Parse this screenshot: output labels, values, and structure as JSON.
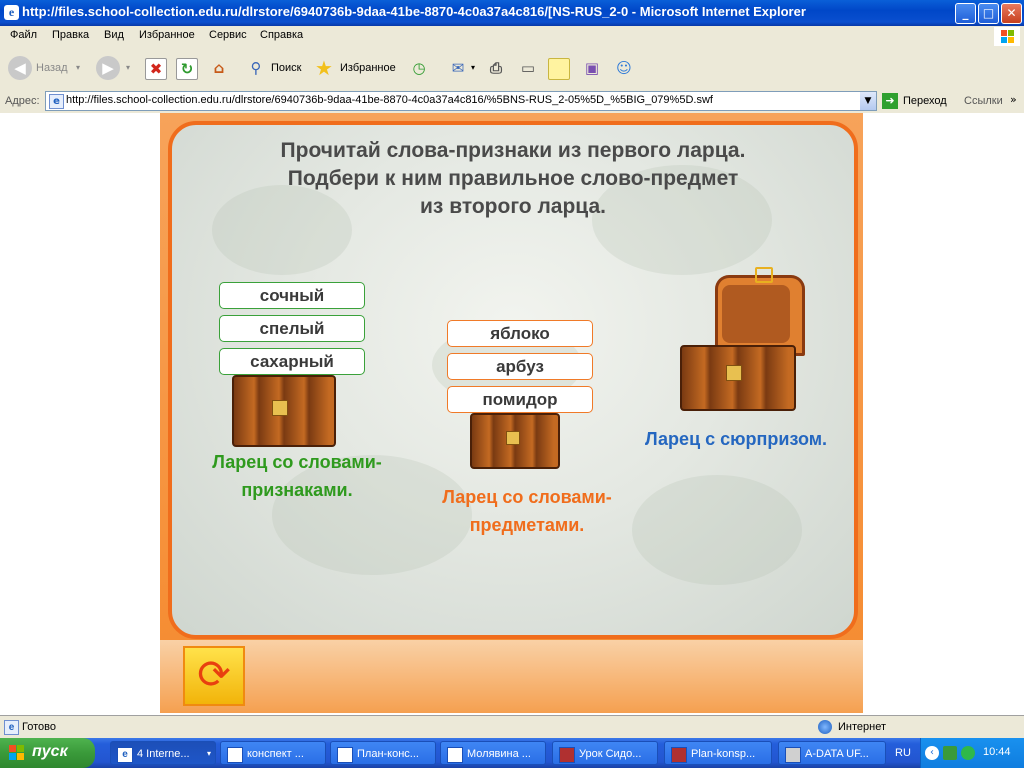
{
  "window": {
    "title": "http://files.school-collection.edu.ru/dlrstore/6940736b-9daa-41be-8870-4c0a37a4c816/[NS-RUS_2-0 - Microsoft Internet Explorer",
    "icon": "ie-icon",
    "controls": {
      "minimize": "_",
      "maximize": "□",
      "close": "✕"
    }
  },
  "menu": {
    "items": [
      "Файл",
      "Правка",
      "Вид",
      "Избранное",
      "Сервис",
      "Справка"
    ]
  },
  "toolbar": {
    "back_label": "Назад",
    "search_label": "Поиск",
    "favorites_label": "Избранное"
  },
  "address": {
    "label": "Адрес:",
    "url": "http://files.school-collection.edu.ru/dlrstore/6940736b-9daa-41be-8870-4c0a37a4c816/%5BNS-RUS_2-05%5D_%5BIG_079%5D.swf",
    "go_label": "Переход",
    "links_label": "Ссылки"
  },
  "lesson": {
    "instruction": [
      "Прочитай слова-признаки из первого ларца.",
      "Подбери к ним правильное слово-предмет",
      "из второго ларца."
    ],
    "adjectives": [
      "сочный",
      "спелый",
      "сахарный"
    ],
    "nouns": [
      "яблоко",
      "арбуз",
      "помидор"
    ],
    "chest1_caption": [
      "Ларец со словами-",
      "признаками."
    ],
    "chest2_caption": [
      "Ларец со словами-",
      "предметами."
    ],
    "chest3_caption": "Ларец с сюрпризом.",
    "colors": {
      "green": "#2f9a1e",
      "orange": "#f06d1c",
      "blue": "#2567c0"
    }
  },
  "status": {
    "left": "Готово",
    "zone": "Интернет"
  },
  "taskbar": {
    "start_label": "пуск",
    "tasks": [
      "4 Interne...",
      "конспект ...",
      "План-конс...",
      "Молявина ...",
      "Урок Сидо...",
      "Plan-konsp...",
      "A-DATA UF..."
    ],
    "lang": "RU",
    "clock": "10:44"
  }
}
